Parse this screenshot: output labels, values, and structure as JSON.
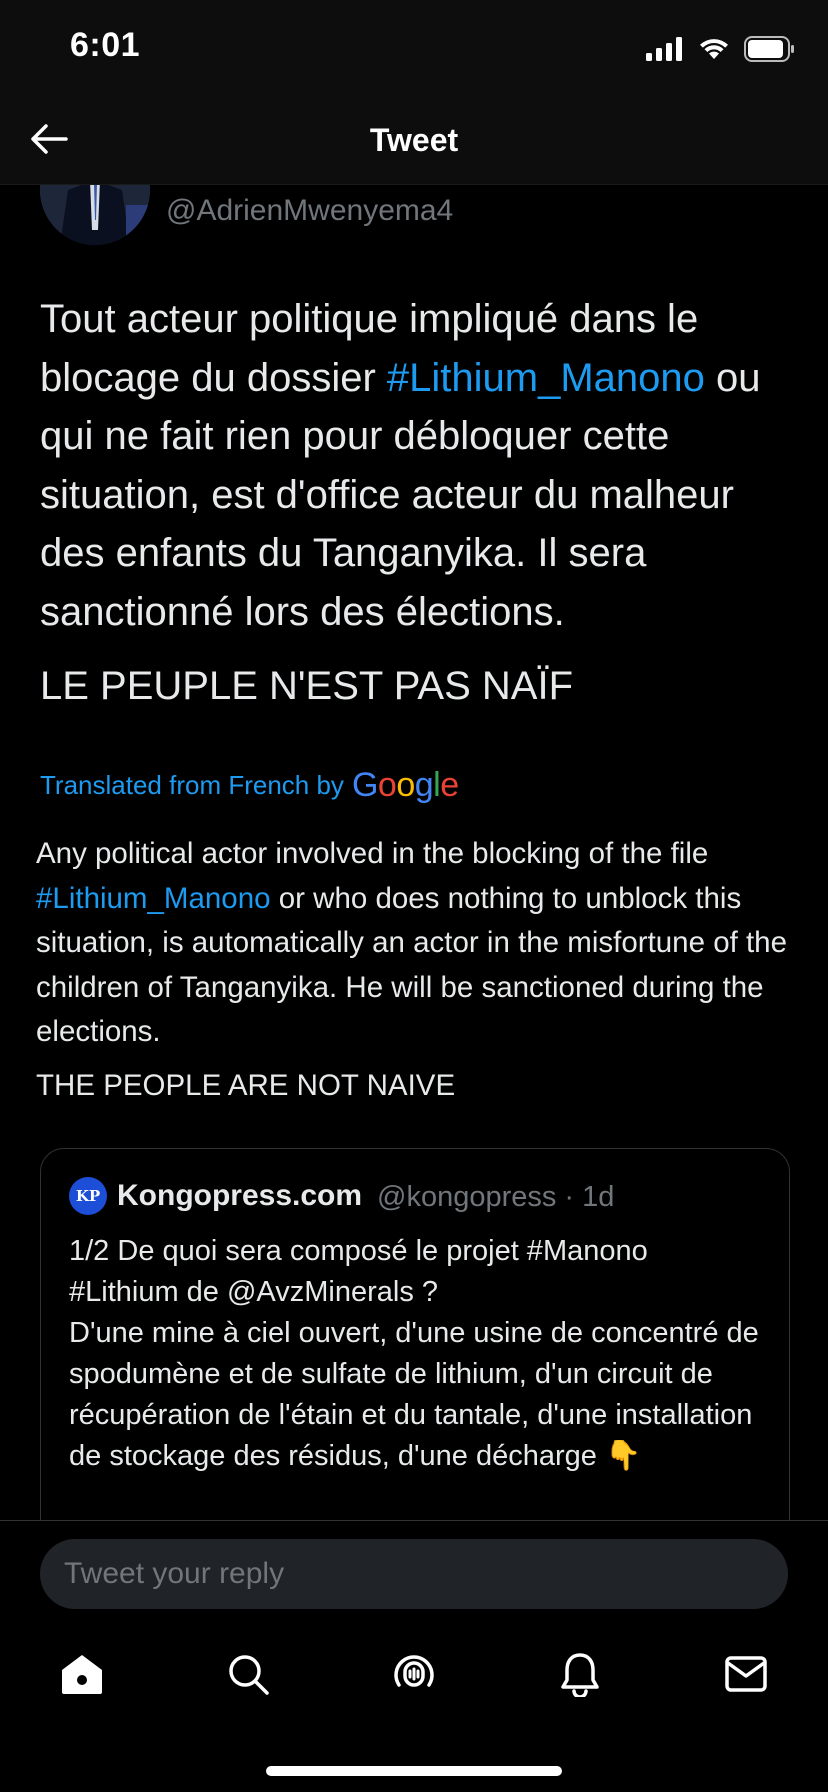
{
  "status_bar": {
    "time": "6:01"
  },
  "header": {
    "title": "Tweet"
  },
  "tweet": {
    "handle": "@AdrienMwenyema4",
    "text_part1": "Tout acteur politique impliqué dans le blocage du dossier ",
    "hashtag": "#Lithium_Manono",
    "text_part2": " ou qui ne fait rien pour débloquer cette situation, est d'office acteur du malheur des enfants du Tanganyika. Il sera sanctionné lors des élections.",
    "text_line2": "LE PEUPLE N'EST PAS NAÏF"
  },
  "translation": {
    "label": "Translated from French by",
    "provider": "Google",
    "text_part1": "Any political actor involved in the blocking of the file ",
    "hashtag": "#Lithium_Manono",
    "text_part2": " or who does nothing to unblock this situation, is automatically an actor in the misfortune of the children of Tanganyika. He will be sanctioned during the elections.",
    "text_line2": "THE PEOPLE ARE NOT NAIVE"
  },
  "quoted_tweet": {
    "avatar_initials": "KP",
    "name": "Kongopress.com",
    "meta": "@kongopress · 1d",
    "text": "1/2 De quoi sera composé le projet #Manono\n#Lithium de @AvzMinerals ?\nD'une mine à ciel ouvert, d'une usine de concentré de spodumène et de sulfate de lithium, d'un circuit de récupération de l'étain et du tantale, d'une installation de stockage des résidus, d'une décharge 👇"
  },
  "reply": {
    "placeholder": "Tweet your reply"
  },
  "tabs": {
    "home": "home-icon",
    "search": "search-icon",
    "spaces": "spaces-icon",
    "notifications": "bell-icon",
    "messages": "mail-icon"
  },
  "colors": {
    "accent": "#1d9bf0",
    "background": "#000000",
    "secondary_text": "#71767b"
  }
}
